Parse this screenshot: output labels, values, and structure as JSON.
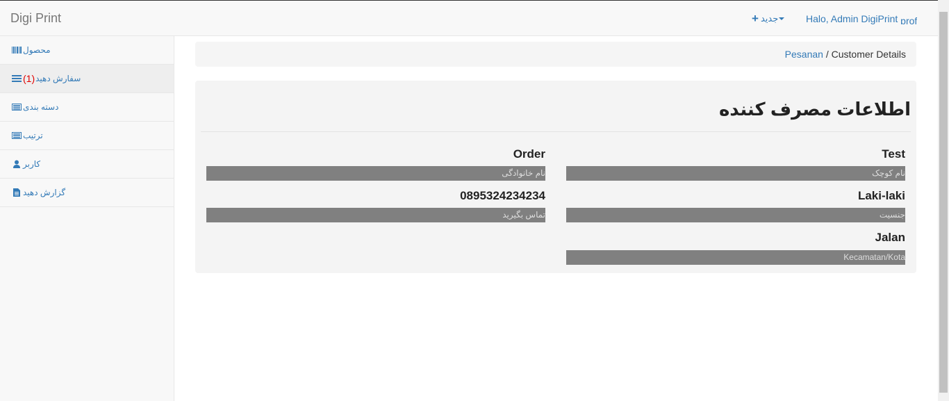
{
  "navbar": {
    "brand": "Digi Print",
    "new_label": "جدید",
    "greeting": "Halo, Admin DigiPrint",
    "profile_label": "prof"
  },
  "sidebar": {
    "items": [
      {
        "label": "محصول",
        "icon": "barcode-icon"
      },
      {
        "label": "سفارش دهید",
        "count": "(1)",
        "icon": "list-icon"
      },
      {
        "label": "دسته بندی",
        "icon": "table-list-icon"
      },
      {
        "label": "ترتیب",
        "icon": "table-list-icon"
      },
      {
        "label": "کاربر",
        "icon": "user-icon"
      },
      {
        "label": "گزارش دهید",
        "icon": "file-icon"
      }
    ]
  },
  "breadcrumb": {
    "link": "Pesanan",
    "separator": "/",
    "current": "Customer Details"
  },
  "panel": {
    "title": "اطلاعات مصرف کننده",
    "fields": [
      {
        "value": "Test",
        "caption": "نام کوچک"
      },
      {
        "value": "Order",
        "caption": "نام خانوادگی"
      },
      {
        "value": "Laki-laki",
        "caption": "جنسیت"
      },
      {
        "value": "0895324234234",
        "caption": "تماس بگیرید"
      },
      {
        "value": "Jalan",
        "caption": "Kecamatan/Kota"
      }
    ]
  },
  "colors": {
    "link": "#337ab7",
    "badge": "#e00000",
    "field_bar": "#808080"
  }
}
